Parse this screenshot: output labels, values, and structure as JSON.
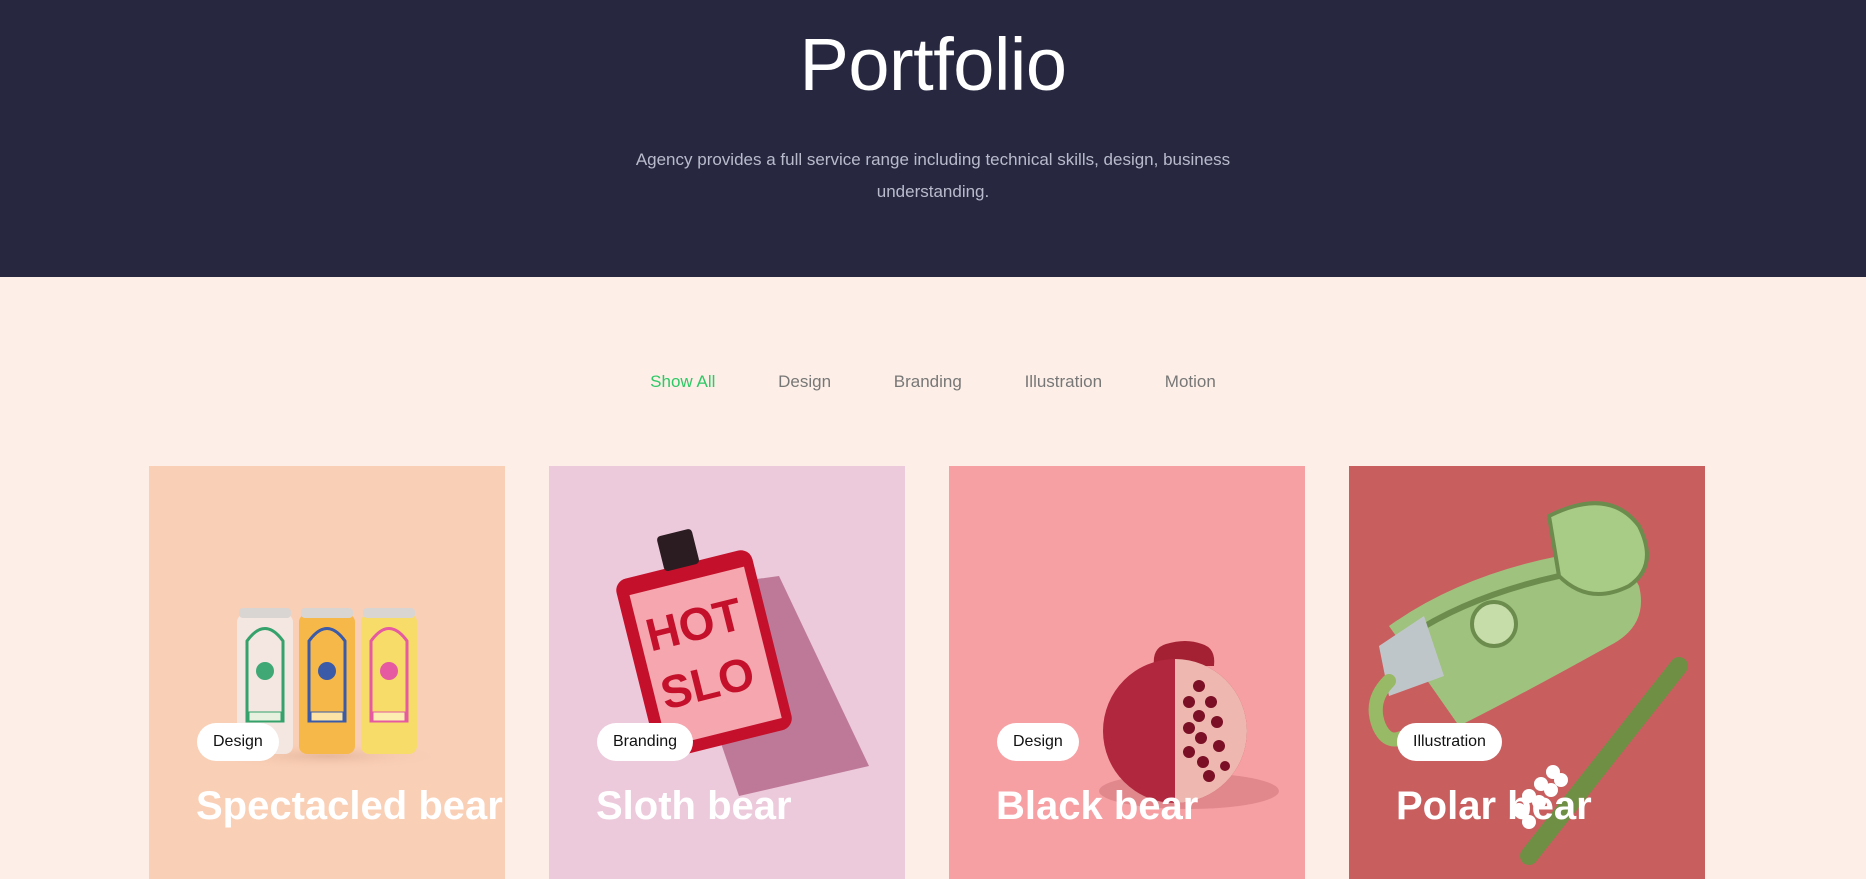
{
  "hero": {
    "title": "Portfolio",
    "subtitle": "Agency provides a full service range including technical skills, design, business understanding."
  },
  "filters": [
    {
      "label": "Show All",
      "active": true
    },
    {
      "label": "Design",
      "active": false
    },
    {
      "label": "Branding",
      "active": false
    },
    {
      "label": "Illustration",
      "active": false
    },
    {
      "label": "Motion",
      "active": false
    }
  ],
  "cards": [
    {
      "title": "Spectacled bear",
      "tag": "Design",
      "image": "sparkling-water-cans-illustration",
      "background": "#f9cfb6"
    },
    {
      "title": "Sloth bear",
      "tag": "Branding",
      "image": "hot-sauce-bottle-illustration",
      "background": "#ecc9db"
    },
    {
      "title": "Black bear",
      "tag": "Design",
      "image": "pomegranate-illustration",
      "background": "#f6a0a4"
    },
    {
      "title": "Polar bear",
      "tag": "Illustration",
      "image": "money-toothpaste-illustration",
      "background": "#c95e5f"
    }
  ],
  "colors": {
    "hero_bg": "#272840",
    "page_bg": "#fdefe7",
    "active_filter": "#2ec866"
  }
}
